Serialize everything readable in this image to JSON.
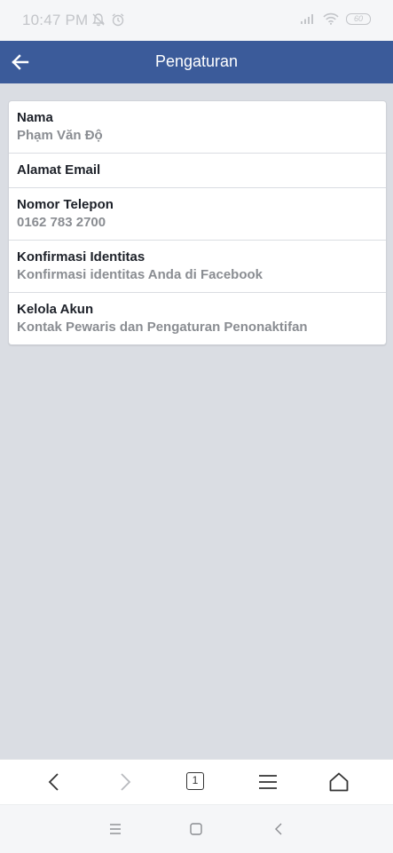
{
  "status_bar": {
    "time": "10:47 PM",
    "battery": "60",
    "icons": [
      "bell-off-icon",
      "alarm-icon",
      "signal-icon",
      "wifi-icon",
      "battery-icon"
    ]
  },
  "app_bar": {
    "title": "Pengaturan",
    "background": "#3b5b9a"
  },
  "settings": {
    "items": [
      {
        "label": "Nama",
        "value": "Phạm Văn Độ"
      },
      {
        "label": "Alamat Email",
        "value": ""
      },
      {
        "label": "Nomor Telepon",
        "value": "0162 783 2700"
      },
      {
        "label": "Konfirmasi Identitas",
        "value": "Konfirmasi identitas Anda di Facebook"
      },
      {
        "label": "Kelola Akun",
        "value": "Kontak Pewaris dan Pengaturan Penonaktifan"
      }
    ]
  },
  "browser_toolbar": {
    "tab_count": "1",
    "icons": [
      "back-icon",
      "forward-icon",
      "tabs-icon",
      "menu-icon",
      "home-icon"
    ]
  },
  "system_nav": {
    "icons": [
      "recents-icon",
      "home-square-icon",
      "back-triangle-icon"
    ]
  }
}
